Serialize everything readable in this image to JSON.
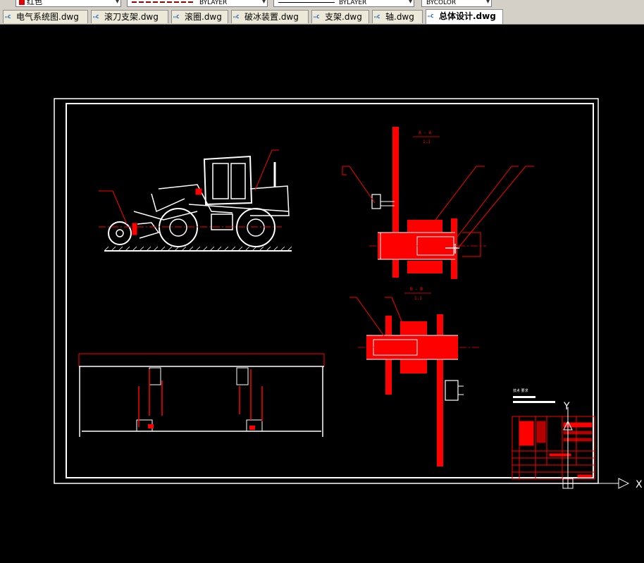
{
  "toolbar": {
    "color_combo": "红色",
    "layer_combo_1": "BYLAYER",
    "layer_combo_2": "BYLAYER",
    "color_combo_2": "BYCOLOR"
  },
  "tabs": [
    {
      "label": "电气系统图.dwg",
      "active": false
    },
    {
      "label": "滚刀支架.dwg",
      "active": false
    },
    {
      "label": "滚圈.dwg",
      "active": false
    },
    {
      "label": "破冰装置.dwg",
      "active": false
    },
    {
      "label": "支架.dwg",
      "active": false
    },
    {
      "label": "轴.dwg",
      "active": false
    },
    {
      "label": "总体设计.dwg",
      "active": true
    }
  ],
  "drawing": {
    "section_a_label": "A - A",
    "section_a_scale": "1:1",
    "section_b_label": "B - B",
    "section_b_scale": "1:1",
    "tech_req_title": "技术 要求",
    "ucs_y": "Y",
    "ucs_x": "X",
    "colors": {
      "red": "#ff0000",
      "white": "#ffffff",
      "background": "#000000"
    }
  }
}
